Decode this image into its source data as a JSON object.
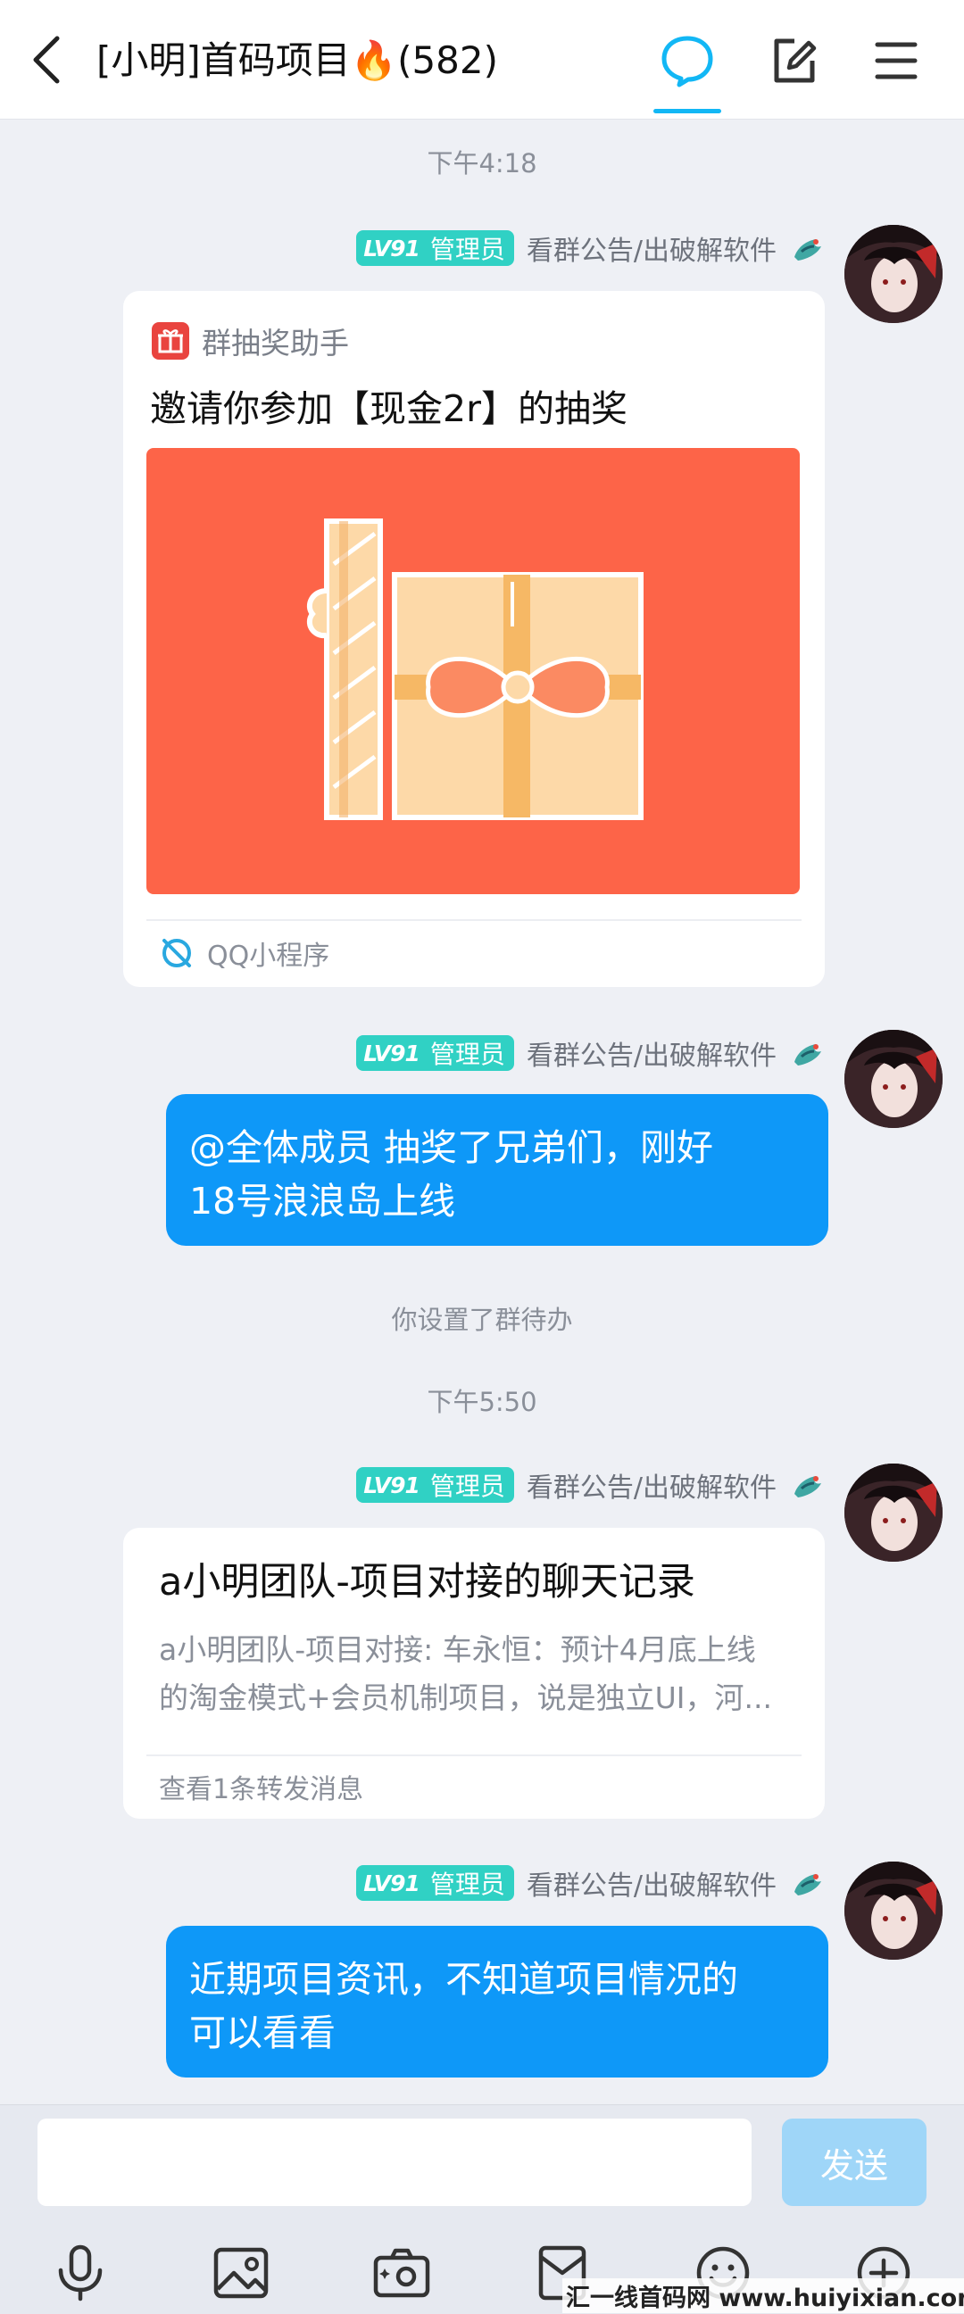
{
  "header": {
    "title": "[小明]首码项目",
    "title_emoji": "🔥",
    "member_count": "(582)"
  },
  "messages": [
    {
      "timestamp": "下午4:18"
    },
    {
      "sender": {
        "level": "LV91",
        "role": "管理员",
        "name": "看群公告/出破解软件"
      },
      "card": {
        "app_name": "群抽奖助手",
        "headline": "邀请你参加【现金2r】的抽奖",
        "footer": "QQ小程序"
      }
    },
    {
      "sender": {
        "level": "LV91",
        "role": "管理员",
        "name": "看群公告/出破解软件"
      },
      "bubble": {
        "line1": "@全体成员 抽奖了兄弟们，刚好",
        "line2": "18号浪浪岛上线"
      }
    },
    {
      "system": "你设置了群待办"
    },
    {
      "timestamp": "下午5:50"
    },
    {
      "sender": {
        "level": "LV91",
        "role": "管理员",
        "name": "看群公告/出破解软件"
      },
      "forward": {
        "title": "a小明团队-项目对接的聊天记录",
        "preview_line1": "a小明团队-项目对接: 车永恒：预计4月底上线",
        "preview_line2": "的淘金模式+会员机制项目，说是独立UI，河...",
        "footer": "查看1条转发消息"
      }
    },
    {
      "sender": {
        "level": "LV91",
        "role": "管理员",
        "name": "看群公告/出破解软件"
      },
      "bubble": {
        "line1": "近期项目资讯，不知道项目情况的",
        "line2": "可以看看"
      }
    }
  ],
  "input_bar": {
    "placeholder": "",
    "send_label": "发送"
  },
  "toolbar_icons": [
    "microphone-icon",
    "image-icon",
    "camera-icon",
    "red-packet-icon",
    "emoji-icon",
    "plus-icon"
  ],
  "watermark": "汇一线首码网 www.huiyixian.com",
  "colors": {
    "accent": "#12b7f5",
    "bubble": "#0e98f8",
    "badge": "#30d1c4",
    "lottery_bg": "#fd6448"
  }
}
